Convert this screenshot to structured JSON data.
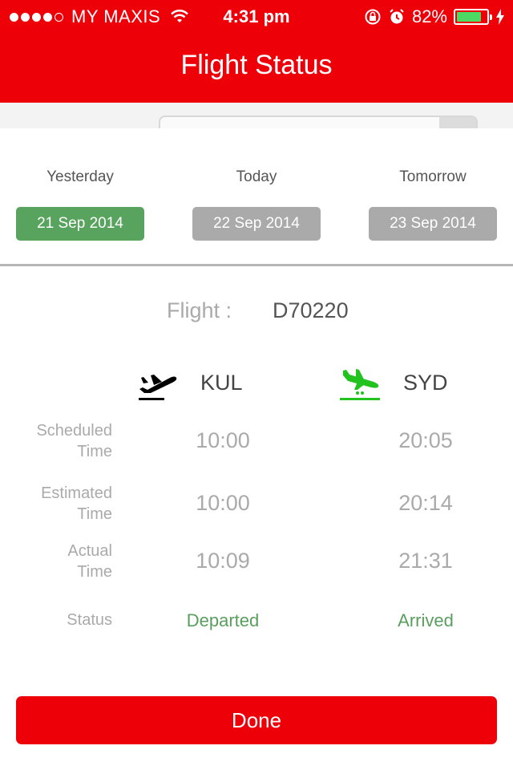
{
  "status_bar": {
    "carrier": "MY MAXIS",
    "time": "4:31 pm",
    "battery_text": "82%",
    "battery_level": 0.82
  },
  "nav": {
    "title": "Flight Status"
  },
  "days": [
    {
      "label": "Yesterday",
      "date": "21 Sep 2014",
      "selected": true
    },
    {
      "label": "Today",
      "date": "22 Sep 2014",
      "selected": false
    },
    {
      "label": "Tomorrow",
      "date": "23 Sep 2014",
      "selected": false
    }
  ],
  "flight": {
    "label": "Flight :",
    "number": "D70220"
  },
  "route": {
    "origin": "KUL",
    "destination": "SYD"
  },
  "rows": [
    {
      "label_line1": "Scheduled",
      "label_line2": "Time",
      "dep": "10:00",
      "arr": "20:05"
    },
    {
      "label_line1": "Estimated",
      "label_line2": "Time",
      "dep": "10:00",
      "arr": "20:14"
    },
    {
      "label_line1": "Actual",
      "label_line2": "Time",
      "dep": "10:09",
      "arr": "21:31"
    }
  ],
  "status_row": {
    "label": "Status",
    "dep": "Departed",
    "arr": "Arrived"
  },
  "done_button": "Done",
  "colors": {
    "brand": "#ee0009",
    "selected": "#58a35e",
    "inactive": "#aaaaaa",
    "status": "#5a9e5f",
    "arrival_icon": "#22c21f"
  },
  "icons": {
    "departure": "plane-departure-icon",
    "arrival": "plane-arrival-icon"
  }
}
